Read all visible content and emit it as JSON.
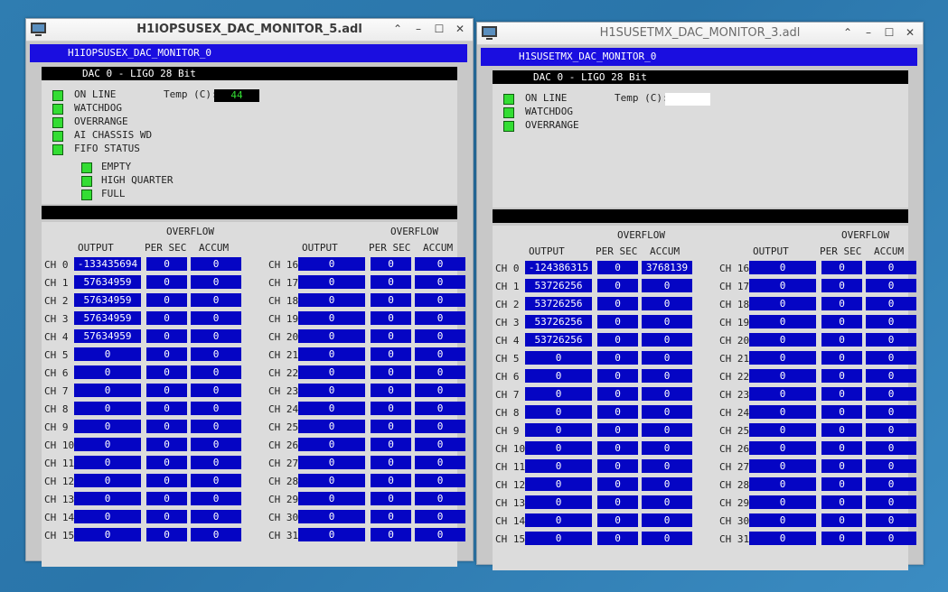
{
  "windows": [
    {
      "title": "H1IOPSUSEX_DAC_MONITOR_5.adl",
      "header": "H1IOPSUSEX_DAC_MONITOR_0",
      "section": "DAC 0 - LIGO 28 Bit",
      "status": [
        "ON LINE",
        "WATCHDOG",
        "OVERRANGE",
        "AI CHASSIS WD",
        "FIFO STATUS"
      ],
      "fifo": [
        "EMPTY",
        "HIGH QUARTER",
        "FULL"
      ],
      "temp_label": "Temp (C):",
      "temp_value": "44",
      "overflow_label": "OVERFLOW",
      "col_output": "OUTPUT",
      "col_per_sec": "PER SEC",
      "col_accum": "ACCUM",
      "channels": [
        [
          "CH 0",
          "-133435694",
          "0",
          "0"
        ],
        [
          "CH 1",
          "57634959",
          "0",
          "0"
        ],
        [
          "CH 2",
          "57634959",
          "0",
          "0"
        ],
        [
          "CH 3",
          "57634959",
          "0",
          "0"
        ],
        [
          "CH 4",
          "57634959",
          "0",
          "0"
        ],
        [
          "CH 5",
          "0",
          "0",
          "0"
        ],
        [
          "CH 6",
          "0",
          "0",
          "0"
        ],
        [
          "CH 7",
          "0",
          "0",
          "0"
        ],
        [
          "CH 8",
          "0",
          "0",
          "0"
        ],
        [
          "CH 9",
          "0",
          "0",
          "0"
        ],
        [
          "CH 10",
          "0",
          "0",
          "0"
        ],
        [
          "CH 11",
          "0",
          "0",
          "0"
        ],
        [
          "CH 12",
          "0",
          "0",
          "0"
        ],
        [
          "CH 13",
          "0",
          "0",
          "0"
        ],
        [
          "CH 14",
          "0",
          "0",
          "0"
        ],
        [
          "CH 15",
          "0",
          "0",
          "0"
        ],
        [
          "CH 16",
          "0",
          "0",
          "0"
        ],
        [
          "CH 17",
          "0",
          "0",
          "0"
        ],
        [
          "CH 18",
          "0",
          "0",
          "0"
        ],
        [
          "CH 19",
          "0",
          "0",
          "0"
        ],
        [
          "CH 20",
          "0",
          "0",
          "0"
        ],
        [
          "CH 21",
          "0",
          "0",
          "0"
        ],
        [
          "CH 22",
          "0",
          "0",
          "0"
        ],
        [
          "CH 23",
          "0",
          "0",
          "0"
        ],
        [
          "CH 24",
          "0",
          "0",
          "0"
        ],
        [
          "CH 25",
          "0",
          "0",
          "0"
        ],
        [
          "CH 26",
          "0",
          "0",
          "0"
        ],
        [
          "CH 27",
          "0",
          "0",
          "0"
        ],
        [
          "CH 28",
          "0",
          "0",
          "0"
        ],
        [
          "CH 29",
          "0",
          "0",
          "0"
        ],
        [
          "CH 30",
          "0",
          "0",
          "0"
        ],
        [
          "CH 31",
          "0",
          "0",
          "0"
        ]
      ]
    },
    {
      "title": "H1SUSETMX_DAC_MONITOR_3.adl",
      "header": "H1SUSETMX_DAC_MONITOR_0",
      "section": "DAC 0 - LIGO 28 Bit",
      "status": [
        "ON LINE",
        "WATCHDOG",
        "OVERRANGE"
      ],
      "fifo": [],
      "temp_label": "Temp (C):",
      "temp_value": "",
      "overflow_label": "OVERFLOW",
      "col_output": "OUTPUT",
      "col_per_sec": "PER SEC",
      "col_accum": "ACCUM",
      "channels": [
        [
          "CH 0",
          "-124386315",
          "0",
          "3768139"
        ],
        [
          "CH 1",
          "53726256",
          "0",
          "0"
        ],
        [
          "CH 2",
          "53726256",
          "0",
          "0"
        ],
        [
          "CH 3",
          "53726256",
          "0",
          "0"
        ],
        [
          "CH 4",
          "53726256",
          "0",
          "0"
        ],
        [
          "CH 5",
          "0",
          "0",
          "0"
        ],
        [
          "CH 6",
          "0",
          "0",
          "0"
        ],
        [
          "CH 7",
          "0",
          "0",
          "0"
        ],
        [
          "CH 8",
          "0",
          "0",
          "0"
        ],
        [
          "CH 9",
          "0",
          "0",
          "0"
        ],
        [
          "CH 10",
          "0",
          "0",
          "0"
        ],
        [
          "CH 11",
          "0",
          "0",
          "0"
        ],
        [
          "CH 12",
          "0",
          "0",
          "0"
        ],
        [
          "CH 13",
          "0",
          "0",
          "0"
        ],
        [
          "CH 14",
          "0",
          "0",
          "0"
        ],
        [
          "CH 15",
          "0",
          "0",
          "0"
        ],
        [
          "CH 16",
          "0",
          "0",
          "0"
        ],
        [
          "CH 17",
          "0",
          "0",
          "0"
        ],
        [
          "CH 18",
          "0",
          "0",
          "0"
        ],
        [
          "CH 19",
          "0",
          "0",
          "0"
        ],
        [
          "CH 20",
          "0",
          "0",
          "0"
        ],
        [
          "CH 21",
          "0",
          "0",
          "0"
        ],
        [
          "CH 22",
          "0",
          "0",
          "0"
        ],
        [
          "CH 23",
          "0",
          "0",
          "0"
        ],
        [
          "CH 24",
          "0",
          "0",
          "0"
        ],
        [
          "CH 25",
          "0",
          "0",
          "0"
        ],
        [
          "CH 26",
          "0",
          "0",
          "0"
        ],
        [
          "CH 27",
          "0",
          "0",
          "0"
        ],
        [
          "CH 28",
          "0",
          "0",
          "0"
        ],
        [
          "CH 29",
          "0",
          "0",
          "0"
        ],
        [
          "CH 30",
          "0",
          "0",
          "0"
        ],
        [
          "CH 31",
          "0",
          "0",
          "0"
        ]
      ]
    }
  ],
  "window_controls": {
    "collapse": "⌃",
    "minimize": "–",
    "maximize": "☐",
    "close": "✕"
  },
  "colors": {
    "field_blue": "#0505c4",
    "header_blue": "#1a0ee0",
    "led_green": "#33dd33",
    "desktop": "#2f7db1"
  }
}
